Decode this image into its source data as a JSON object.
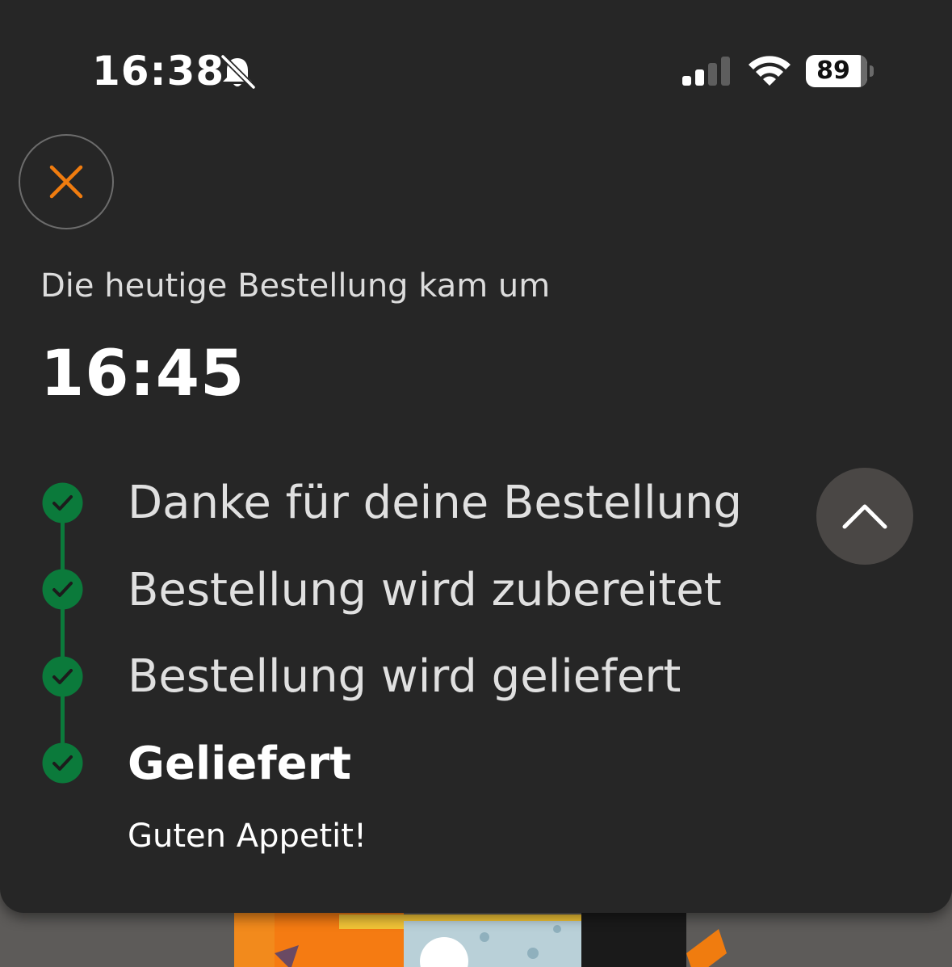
{
  "status_bar": {
    "time": "16:38",
    "battery_level": "89",
    "icons": [
      "bell-slash-icon",
      "cellular-signal-icon",
      "wifi-icon",
      "battery-icon"
    ]
  },
  "header": {
    "close_icon": "close-icon",
    "subtitle": "Die heutige Bestellung kam um",
    "delivery_time": "16:45"
  },
  "progress": {
    "steps": [
      {
        "label": "Danke für deine Bestellung",
        "done": true
      },
      {
        "label": "Bestellung wird zubereitet",
        "done": true
      },
      {
        "label": "Bestellung wird geliefert",
        "done": true
      },
      {
        "label": "Geliefert",
        "done": true,
        "current": true
      }
    ],
    "current_note": "Guten Appetit!",
    "collapse_icon": "chevron-up-icon"
  },
  "colors": {
    "sheet_background": "#262626",
    "accent": "#f07c0f",
    "success_green": "#0b7a3b",
    "collapse_button": "#4a4745"
  }
}
